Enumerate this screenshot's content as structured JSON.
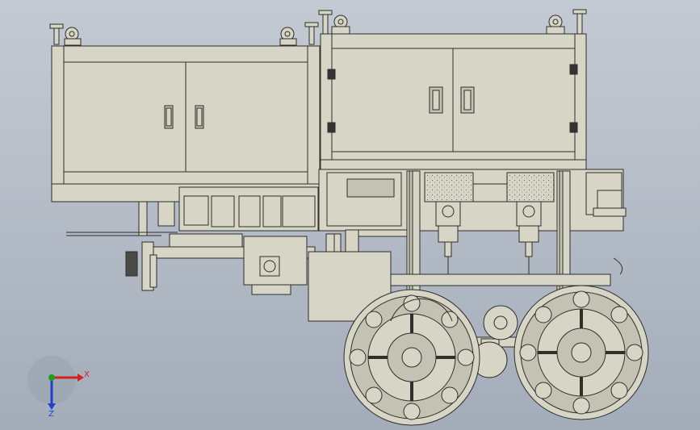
{
  "colors": {
    "background_top": "#c3cad3",
    "background_bottom": "#a3acb9",
    "part_fill": "#d6d5c6",
    "part_fill_dark": "#c4c3b3",
    "edge": "#2e2e2a",
    "axis_x": "#d42020",
    "axis_y": "#1ea01e",
    "axis_z": "#2040d0"
  },
  "triad": {
    "x_label": "X",
    "z_label": "Z"
  },
  "icons": {
    "triad": "coordinate-triad-icon"
  }
}
